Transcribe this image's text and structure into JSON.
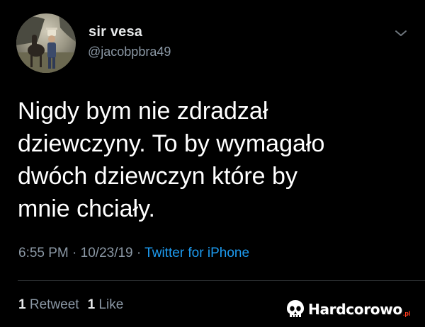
{
  "author": {
    "display_name": "sir vesa",
    "handle": "@jacobpbra49"
  },
  "tweet": {
    "text": "Nigdy bym nie zdradzał\ndziewczyny. To by wymagało\ndwóch dziewczyn które by\nmnie chciały.",
    "time": "6:55 PM",
    "separator": "·",
    "date": "10/23/19",
    "source": "Twitter for iPhone"
  },
  "stats": {
    "retweets_count": "1",
    "retweets_label": "Retweet",
    "likes_count": "1",
    "likes_label": "Like"
  },
  "watermark": {
    "text": "Hardcorowo",
    "tld": ".pl"
  },
  "icons": {
    "menu": "chevron-down-icon",
    "watermark_logo": "skull-icon"
  },
  "colors": {
    "background": "#000000",
    "text": "#ffffff",
    "secondary": "#8b98a5",
    "link": "#1d9bf0"
  }
}
